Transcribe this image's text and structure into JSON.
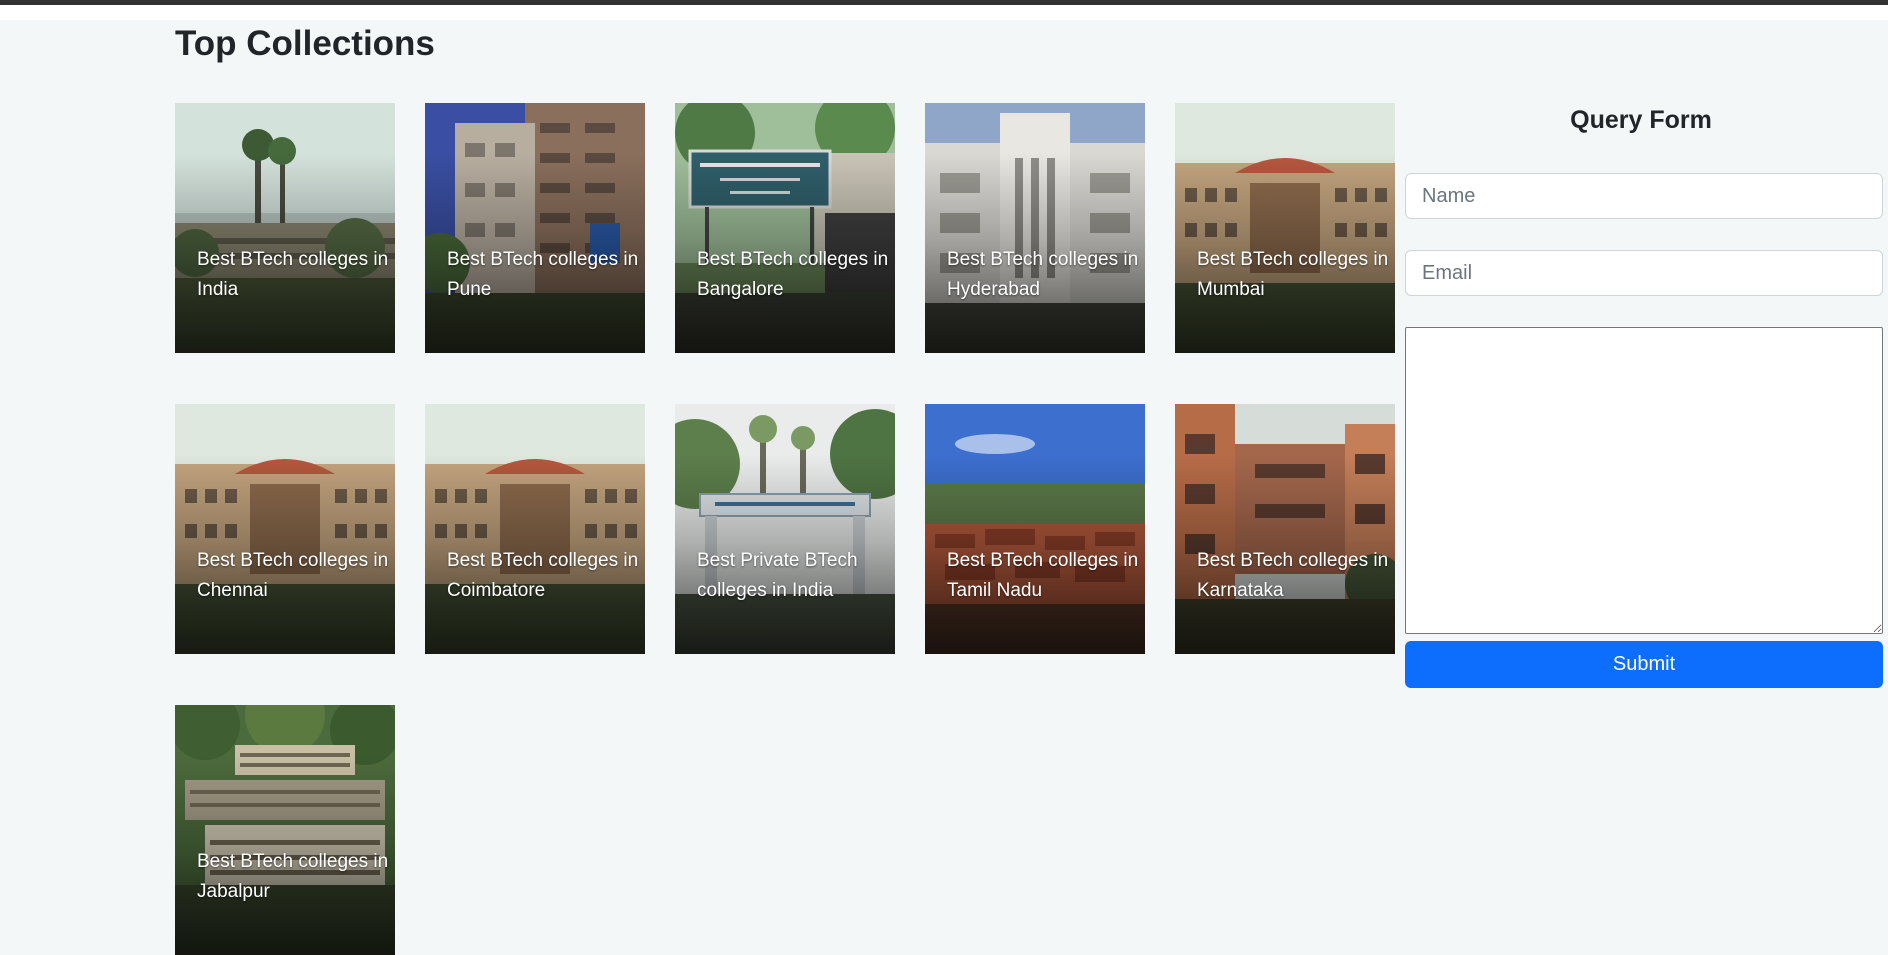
{
  "page": {
    "title": "Top Collections"
  },
  "collections": [
    {
      "label": "Best BTech colleges in India",
      "image": "campus-india"
    },
    {
      "label": "Best BTech colleges in Pune",
      "image": "campus-pune"
    },
    {
      "label": "Best BTech colleges in Bangalore",
      "image": "campus-bangalore"
    },
    {
      "label": "Best BTech colleges in Hyderabad",
      "image": "campus-hyderabad"
    },
    {
      "label": "Best BTech colleges in Mumbai",
      "image": "campus-mumbai"
    },
    {
      "label": "Best BTech colleges in Chennai",
      "image": "campus-chennai"
    },
    {
      "label": "Best BTech colleges in Coimbatore",
      "image": "campus-coimbatore"
    },
    {
      "label": "Best Private BTech colleges in India",
      "image": "campus-private"
    },
    {
      "label": "Best BTech colleges in Tamil Nadu",
      "image": "campus-tamil-nadu"
    },
    {
      "label": "Best BTech colleges in Karnataka",
      "image": "campus-karnataka"
    },
    {
      "label": "Best BTech colleges in Jabalpur",
      "image": "campus-jabalpur"
    }
  ],
  "query_form": {
    "title": "Query Form",
    "name_placeholder": "Name",
    "name_value": "",
    "email_placeholder": "Email",
    "email_value": "",
    "message_value": "",
    "submit_label": "Submit"
  },
  "colors": {
    "page_background": "#f4f7f8",
    "submit_button": "#0d6efd",
    "top_bar": "#333333"
  }
}
